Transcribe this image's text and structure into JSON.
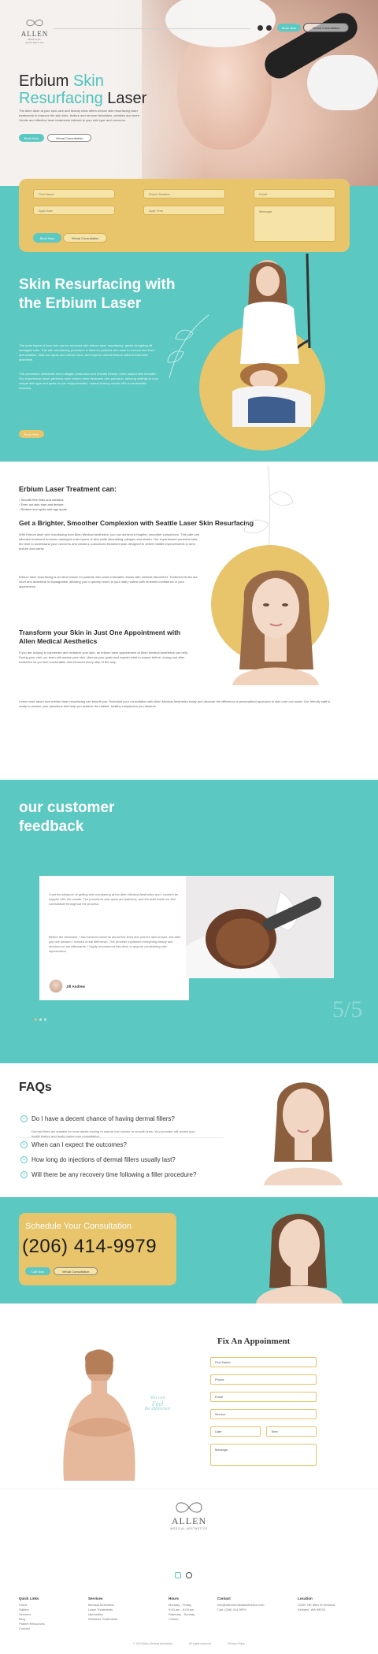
{
  "header": {
    "logo_name": "ALLEN",
    "logo_sub": "MEDICAL AESTHETICS",
    "book_label": "Book Now",
    "consult_label": "Virtual Consultation"
  },
  "hero": {
    "title_1a": "Erbium",
    "title_1b": "Skin",
    "title_2a": "Resurfacing",
    "title_2b": "Laser",
    "text": "The Allen laser at your skin care and beauty clinic offers erbium skin resurfacing laser treatments to improve the skin tone, texture and remove blemishes, wrinkles and more. Gentle and effective laser treatments tailored to your skin type and concerns.",
    "book_label": "Book Now",
    "consult_label": "Virtual Consultation"
  },
  "form": {
    "fields": [
      "First Name",
      "Phone Number",
      "Email",
      "Appt Date",
      "Appt Time",
      "Message"
    ],
    "submit_label": "Book Now",
    "consult_label": "Virtual Consultation"
  },
  "section2": {
    "title": "Skin Resurfacing with the Erbium Laser",
    "p1": "The outer layers of your skin can be removed with erbium laser resurfacing, gently sloughing off damaged cells. This skin resurfacing procedure is ideal for patients who want to smooth fine lines and wrinkles, treat sun spots and uneven tone, and improve overall texture without extensive downtime.",
    "p2": "This procedure stimulates new collagen production and reveals fresher, more radiant skin beneath. Our experienced team performs each erbium laser treatment with precision, tailoring settings to your unique skin type and goals so you enjoy beautiful, natural-looking results with a comfortable recovery.",
    "button": "Book Now"
  },
  "section3": {
    "heading1": "Erbium Laser Treatment can:",
    "bullets": [
      "Smooth fine lines and wrinkles",
      "Even out skin tone and texture",
      "Reduce sun spots and age spots"
    ],
    "heading2": "Get a Brighter, Smoother Complexion with Seattle Laser Skin Resurfacing",
    "p1": "With Erbium laser skin resurfacing from Allen Medical Aesthetics, you can achieve a brighter, smoother complexion. This safe and effective treatment removes damaged outer layers of skin while stimulating collagen and elastin. Our experienced providers take the time to understand your concerns and create a customized treatment plan designed to deliver visible improvements in tone, texture and clarity.",
    "p2": "Erbium laser resurfacing is an ideal choice for patients who want noticeable results with minimal discomfort. Treatment times are short and downtime is manageable, allowing you to quickly return to your daily routine with renewed confidence in your appearance.",
    "heading3": "Transform your Skin in Just One Appointment with Allen Medical Aesthetics",
    "p3": "If you are looking to rejuvenate and revitalize your skin, an erbium laser appointment at Allen Medical Aesthetics can help. During your visit, our team will assess your skin, discuss your goals and explain what to expect before, during and after treatment so you feel comfortable and informed every step of the way.",
    "p4": "Learn more about how erbium laser resurfacing can benefit you. Schedule your consultation with Allen Medical Aesthetics today and discover the difference a personalized approach to skin care can make. Our friendly staff is ready to answer your questions and help you achieve the radiant, healthy complexion you deserve."
  },
  "section4": {
    "title": "our customer feedback",
    "quote": "I had the pleasure of getting skin resurfacing at the Allen Medical Aesthetics and I couldn't be happier with the results. The procedure was quick and painless, and the staff made me feel comfortable throughout the process.",
    "quote2": "Before the treatment, I had several concerns about fine lines and uneven skin texture, but after just one session I noticed a real difference. The provider explained everything clearly and checked on me afterwards. I highly recommend this clinic to anyone considering skin rejuvenation.",
    "name": "Jill Andrew",
    "ghost": "5/5"
  },
  "faq": {
    "title": "FAQs",
    "items": [
      "Do I have a decent chance of having dermal fillers?",
      "When can I expect the outcomes?",
      "How long do injections of dermal fillers usually last?",
      "Will there be any recovery time following a filler procedure?"
    ],
    "answer": "Dermal fillers are suitable for most adults looking to restore lost volume or smooth lines. Your provider will review your health history and goals during your consultation.",
    "open_icon": "−",
    "closed_icon": "+"
  },
  "schedule": {
    "title": "Schedule Your Consultation",
    "phone": "(206) 414-9979",
    "call_label": "Call Now",
    "consult_label": "Virtual Consultation"
  },
  "appointment": {
    "title": "Fix An Appoinment",
    "fields": [
      "First Name",
      "Phone",
      "Email",
      "Service",
      "Date",
      "Time",
      "Message"
    ],
    "script_1": "You can",
    "script_2": "Feel",
    "script_3": "the difference"
  },
  "footer": {
    "logo_name": "ALLEN",
    "logo_sub": "MEDICAL AESTHETICS",
    "col1_title": "Quick Links",
    "col1": [
      "Home",
      "Gallery",
      "Services",
      "Blog",
      "Patient Resources",
      "Contact"
    ],
    "col2_title": "Services",
    "col2": [
      "Medical Aesthetics",
      "Laser Treatments",
      "Injectables",
      "Wellness Treatments"
    ],
    "col3_title": "Hours",
    "col3": [
      "Monday - Friday",
      "9:00 am - 6:00 pm",
      "Saturday - Sunday",
      "Closed"
    ],
    "col4_title": "Contact",
    "col4": [
      "info@allenmedicalaesthetics.com",
      "Call: (206) 414-9979"
    ],
    "col5_title": "Location",
    "col5": [
      "12607 NE 85th St Kirkland,",
      "Kirkland, WA 98033"
    ],
    "bottom": [
      "© 2023 Allen Medical Aesthetics",
      "All rights reserved",
      "Privacy Policy"
    ]
  },
  "colors": {
    "teal": "#5bc8c1",
    "gold": "#e8c46a",
    "text": "#2b2b2b"
  }
}
